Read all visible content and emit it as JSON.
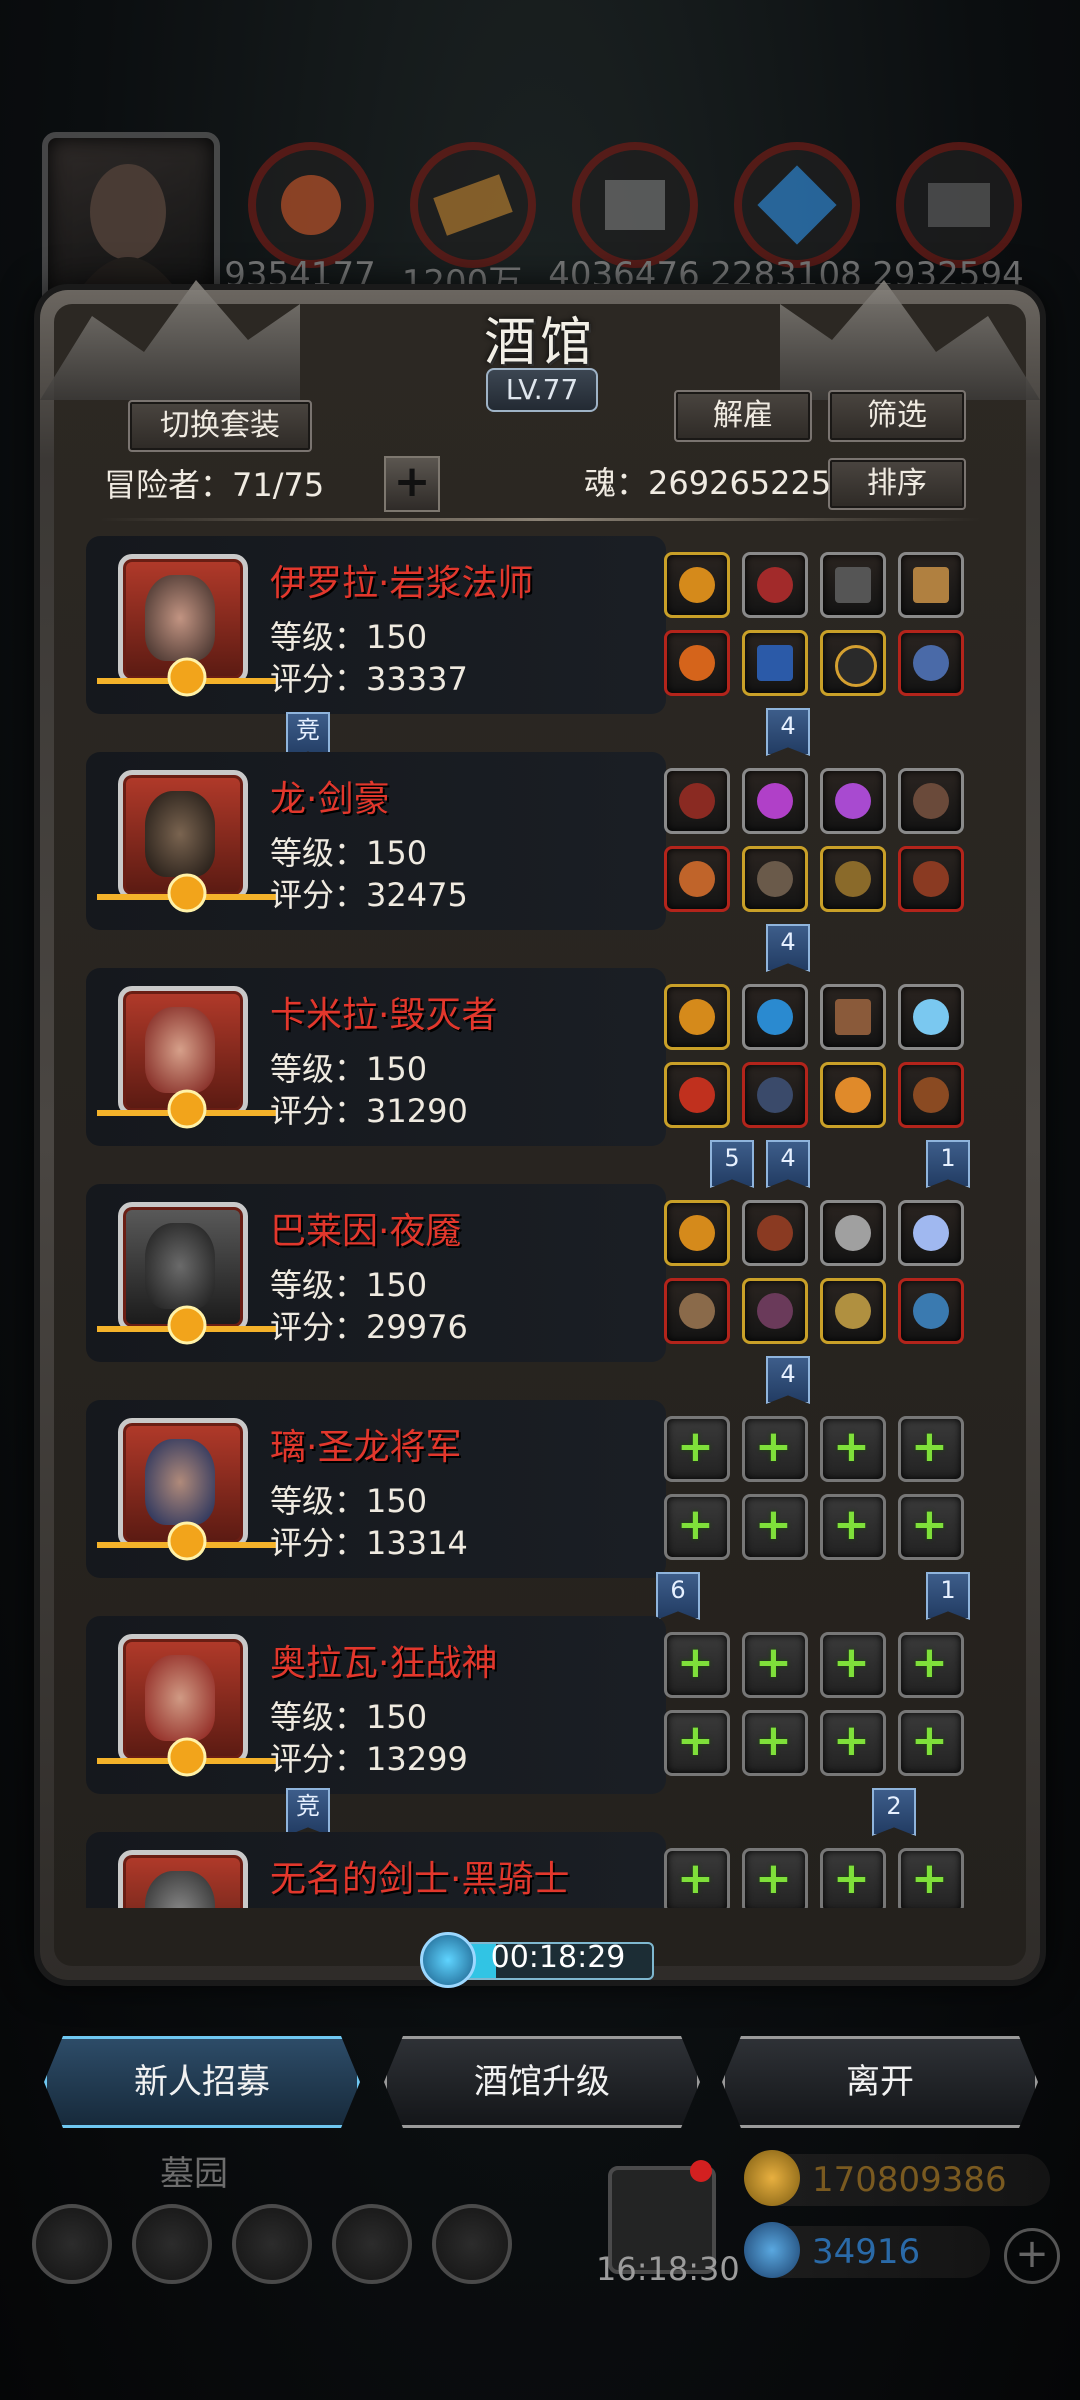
{
  "topbar": {
    "resources": [
      "9354177",
      "1200万",
      "4036476",
      "2283108",
      "2932594"
    ]
  },
  "panel": {
    "title": "酒馆",
    "level": "LV.77",
    "switch_set_label": "切换套装",
    "fire_label": "解雇",
    "filter_label": "筛选",
    "sort_label": "排序",
    "adventurer_label": "冒险者：71/75",
    "soul_label": "魂：269265225"
  },
  "heroes": [
    {
      "name": "伊罗拉·岩浆法师",
      "level": "等级：150",
      "score": "评分：33337",
      "badges": [
        {
          "text": "竞"
        },
        {
          "text": "4"
        }
      ]
    },
    {
      "name": "龙·剑豪",
      "level": "等级：150",
      "score": "评分：32475",
      "badges": [
        {
          "text": "4"
        }
      ]
    },
    {
      "name": "卡米拉·毁灭者",
      "level": "等级：150",
      "score": "评分：31290",
      "badges": [
        {
          "text": "5"
        },
        {
          "text": "4"
        },
        {
          "text": "1"
        }
      ]
    },
    {
      "name": "巴莱因·夜魇",
      "level": "等级：150",
      "score": "评分：29976",
      "badges": [
        {
          "text": "4"
        }
      ]
    },
    {
      "name": "璃·圣龙将军",
      "level": "等级：150",
      "score": "评分：13314",
      "badges": [
        {
          "text": "6"
        },
        {
          "text": "1"
        }
      ]
    },
    {
      "name": "奥拉瓦·狂战神",
      "level": "等级：150",
      "score": "评分：13299",
      "badges": [
        {
          "text": "竞"
        },
        {
          "text": "2"
        }
      ]
    },
    {
      "name": "无名的剑士·黑骑士",
      "level": "",
      "score": "",
      "badges": []
    }
  ],
  "timer": {
    "value": "00:18:29",
    "progress": 0.18
  },
  "buttons": {
    "recruit": "新人招募",
    "upgrade": "酒馆升级",
    "leave": "离开"
  },
  "hud": {
    "graveyard": "墓园",
    "clock": "16:18:30",
    "gold": "170809386",
    "gems": "34916",
    "add": "+"
  },
  "colors": {
    "hero_name": "#e2372c",
    "accent": "#31c4e4",
    "add_icon": "#7fe03a"
  }
}
